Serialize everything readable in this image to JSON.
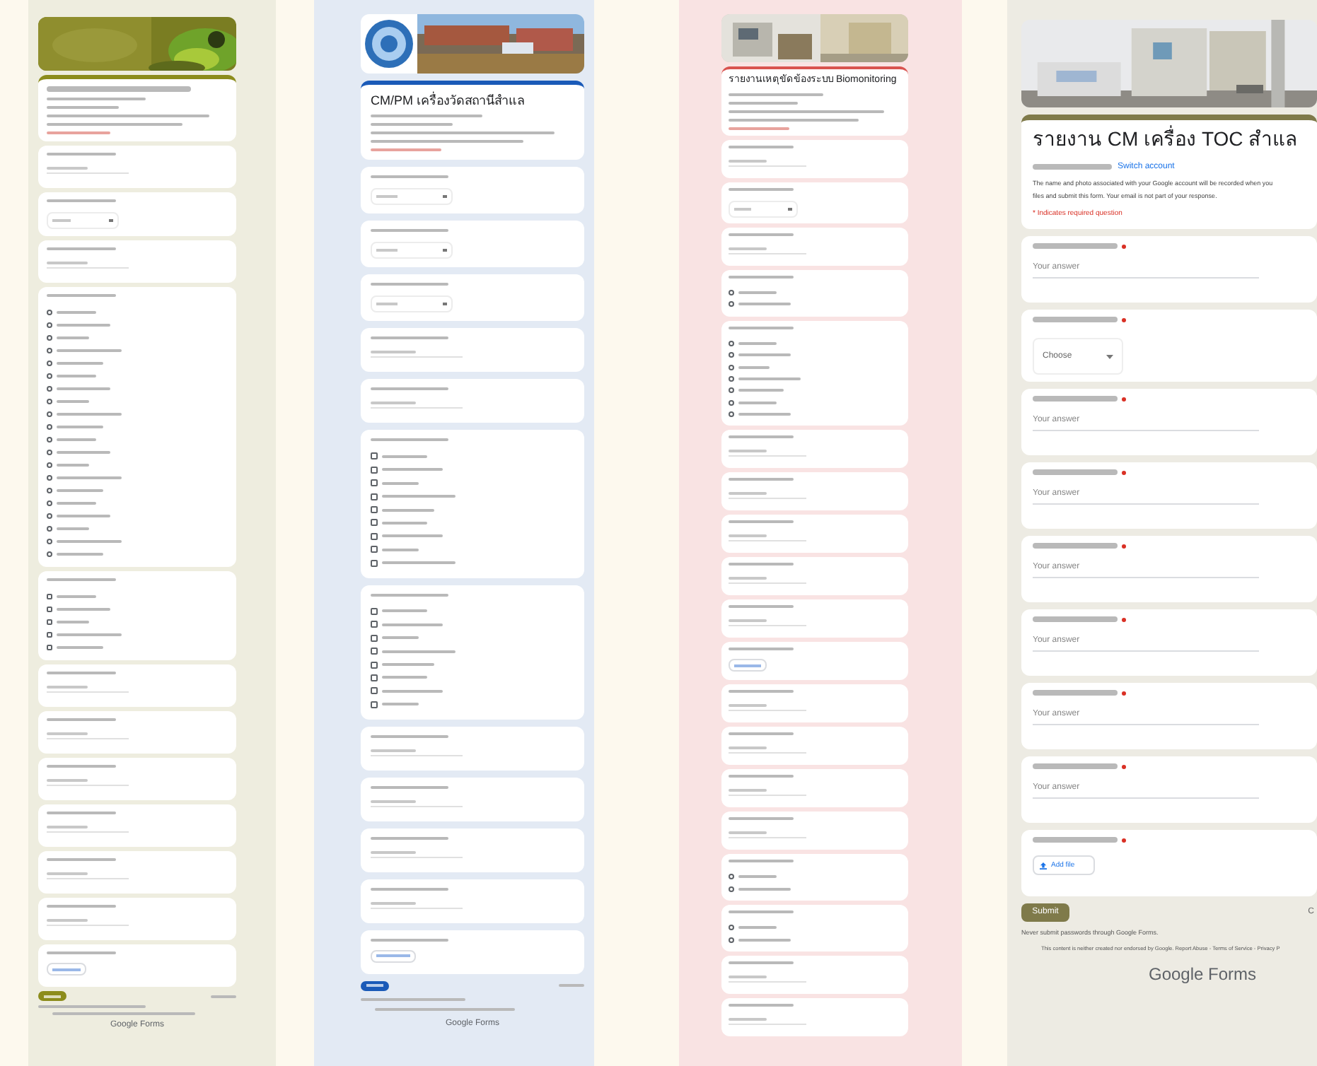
{
  "forms": [
    {
      "color": "#8c8c1c",
      "header": {
        "kind": "picture"
      },
      "has_submit": true,
      "footer_brand": "Google Forms",
      "questions": [
        {
          "kind": "text"
        },
        {
          "kind": "dropdown"
        },
        {
          "kind": "text"
        },
        {
          "kind": "radio",
          "options": [
            {
              "selected": false
            },
            {
              "selected": false
            },
            {
              "selected": false
            },
            {
              "selected": false
            },
            {
              "selected": false
            },
            {
              "selected": false
            },
            {
              "selected": false
            },
            {
              "selected": false
            },
            {
              "selected": false
            },
            {
              "selected": false
            },
            {
              "selected": false
            },
            {
              "selected": false
            },
            {
              "selected": false
            },
            {
              "selected": false
            },
            {
              "selected": false
            },
            {
              "selected": false
            },
            {
              "selected": false
            },
            {
              "selected": false
            },
            {
              "selected": false
            },
            {
              "selected": false
            }
          ]
        },
        {
          "kind": "checkbox",
          "options": [
            {
              "checked": false
            },
            {
              "checked": false
            },
            {
              "checked": false
            },
            {
              "checked": false
            },
            {
              "checked": false
            }
          ]
        },
        {
          "kind": "text"
        },
        {
          "kind": "text"
        },
        {
          "kind": "text"
        },
        {
          "kind": "text"
        },
        {
          "kind": "text"
        },
        {
          "kind": "text"
        },
        {
          "kind": "file"
        }
      ]
    },
    {
      "color": "#1a5ab8",
      "header": {
        "kind": "picture"
      },
      "title": "CM/PM เครื่องวัดสถานีสำแล",
      "has_submit": true,
      "footer_brand": "Google Forms",
      "questions": [
        {
          "kind": "dropdown"
        },
        {
          "kind": "dropdown"
        },
        {
          "kind": "dropdown"
        },
        {
          "kind": "text"
        },
        {
          "kind": "text"
        },
        {
          "kind": "checkbox",
          "options": [
            {
              "checked": false
            },
            {
              "checked": false
            },
            {
              "checked": false
            },
            {
              "checked": false
            },
            {
              "checked": false
            },
            {
              "checked": false
            },
            {
              "checked": false
            },
            {
              "checked": false
            },
            {
              "checked": false
            }
          ]
        },
        {
          "kind": "checkbox",
          "options": [
            {
              "checked": false
            },
            {
              "checked": false
            },
            {
              "checked": false
            },
            {
              "checked": false
            },
            {
              "checked": false
            },
            {
              "checked": false
            },
            {
              "checked": false
            },
            {
              "checked": false
            }
          ]
        },
        {
          "kind": "text"
        },
        {
          "kind": "text"
        },
        {
          "kind": "text"
        },
        {
          "kind": "text"
        },
        {
          "kind": "file"
        }
      ]
    },
    {
      "color": "#d9534f",
      "header": {
        "kind": "picture"
      },
      "title": "รายงานเหตุขัดข้องระบบ Biomonitoring",
      "has_submit": false,
      "questions": [
        {
          "kind": "text"
        },
        {
          "kind": "dropdown"
        },
        {
          "kind": "text"
        },
        {
          "kind": "radio",
          "options": [
            {
              "selected": false
            },
            {
              "selected": false
            }
          ]
        },
        {
          "kind": "radio",
          "options": [
            {
              "selected": false
            },
            {
              "selected": false
            },
            {
              "selected": false
            },
            {
              "selected": false
            },
            {
              "selected": false
            },
            {
              "selected": false
            },
            {
              "selected": false
            }
          ]
        },
        {
          "kind": "text"
        },
        {
          "kind": "text"
        },
        {
          "kind": "text"
        },
        {
          "kind": "text"
        },
        {
          "kind": "text"
        },
        {
          "kind": "file"
        },
        {
          "kind": "text"
        },
        {
          "kind": "text"
        },
        {
          "kind": "text"
        },
        {
          "kind": "text"
        },
        {
          "kind": "radio",
          "options": [
            {
              "selected": false
            },
            {
              "selected": false
            }
          ]
        },
        {
          "kind": "radio",
          "options": [
            {
              "selected": false
            },
            {
              "selected": false
            }
          ]
        },
        {
          "kind": "text"
        },
        {
          "kind": "text"
        }
      ]
    },
    {
      "color": "#7f7a4a",
      "header": {
        "kind": "picture"
      },
      "title": "รายงาน CM เครื่อง TOC สำแล",
      "switch_account": "Switch account",
      "notice": [
        "The name and photo associated with your Google account will be recorded when you",
        "files and submit this form. Your email is not part of your response."
      ],
      "required_note": "* Indicates required question",
      "has_submit": true,
      "submit": "Submit",
      "clear": "C",
      "never_submit": "Never submit passwords through Google Forms.",
      "disclaimer": "This content is neither created nor endorsed by Google. Report Abuse - Terms of Service - Privacy P",
      "footer_brand": "Google Forms",
      "questions": [
        {
          "kind": "text",
          "required": true,
          "placeholder": "Your answer"
        },
        {
          "kind": "dropdown",
          "required": true,
          "placeholder": "Choose"
        },
        {
          "kind": "text",
          "required": true,
          "placeholder": "Your answer"
        },
        {
          "kind": "text",
          "required": true,
          "placeholder": "Your answer"
        },
        {
          "kind": "text",
          "required": true,
          "placeholder": "Your answer"
        },
        {
          "kind": "text",
          "required": true,
          "placeholder": "Your answer"
        },
        {
          "kind": "text",
          "required": true,
          "placeholder": "Your answer"
        },
        {
          "kind": "text",
          "required": true,
          "placeholder": "Your answer"
        },
        {
          "kind": "file",
          "required": true,
          "placeholder": "Add file"
        }
      ]
    }
  ]
}
